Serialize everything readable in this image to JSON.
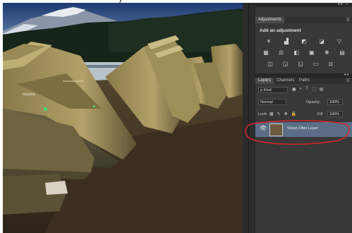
{
  "caption_fragment": "y",
  "panels": {
    "adjustments_tab": "Adjustments",
    "add_adjustment": "Add an adjustment",
    "adjust_icons_row1": [
      "brightness-icon",
      "levels-icon",
      "curves-icon",
      "exposure-icon",
      "vibrance-icon"
    ],
    "adjust_icons_row2": [
      "hue-sat-icon",
      "color-balance-icon",
      "bw-icon",
      "photo-filter-icon",
      "channel-mixer-icon",
      "color-lookup-icon"
    ],
    "adjust_icons_row3": [
      "invert-icon",
      "posterize-icon",
      "threshold-icon",
      "gradient-map-icon",
      "selective-color-icon"
    ],
    "layers_tabs": [
      "Layers",
      "Channels",
      "Paths"
    ],
    "kind_filter": "ρ Kind",
    "blend_mode": "Normal",
    "opacity_label": "Opacity:",
    "opacity_value": "100%",
    "lock_label": "Lock:",
    "fill_label": "Fill:",
    "fill_value": "100%",
    "layer_name": "Smart Filter Layer",
    "accent": "#5b6e86",
    "annotation_color": "#d6242a"
  }
}
